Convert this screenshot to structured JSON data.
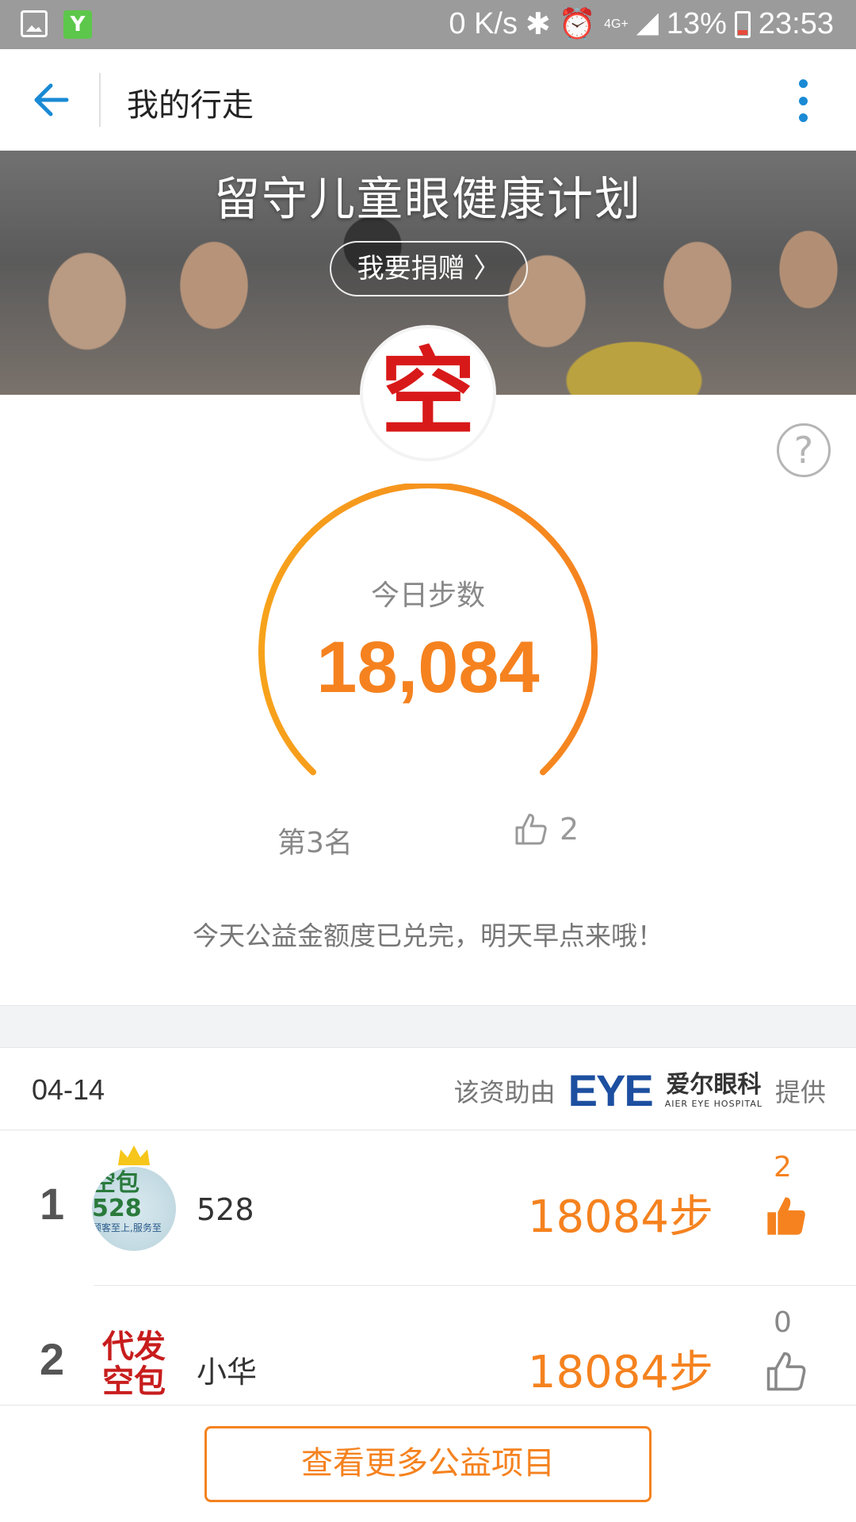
{
  "status_bar": {
    "network_speed": "0 K/s",
    "network_type": "4G+",
    "battery": "13%",
    "time": "23:53",
    "icons": [
      "image-icon",
      "y-app-icon",
      "bluetooth-icon",
      "alarm-icon",
      "signal-icon",
      "battery-icon"
    ]
  },
  "header": {
    "title": "我的行走",
    "back_icon": "arrow-left-icon",
    "more_icon": "more-vertical-icon",
    "accent_color": "#1a8ad4"
  },
  "banner": {
    "title": "留守儿童眼健康计划",
    "donate_label": "我要捐赠 〉"
  },
  "profile": {
    "avatar_text": "空",
    "help_icon": "?"
  },
  "today": {
    "label": "今日步数",
    "steps": "18,084",
    "rank": "第3名",
    "likes": "2",
    "notice": "今天公益金额度已兑完，明天早点来哦！"
  },
  "leaderboard": {
    "date": "04-14",
    "sponsor_prefix": "该资助由",
    "sponsor_logo": "EYE",
    "sponsor_name_cn": "爱尔眼科",
    "sponsor_name_en": "AIER EYE HOSPITAL",
    "sponsor_suffix": "提供",
    "rows": [
      {
        "rank": "1",
        "name": "528",
        "steps": "18084步",
        "likes": "2",
        "liked": true,
        "avatar_text_main": "空包528",
        "avatar_text_sub": "顾客至上,服务至诚。"
      },
      {
        "rank": "2",
        "name": "小华",
        "steps": "18084步",
        "likes": "0",
        "liked": false,
        "avatar_line1": "代发",
        "avatar_line2": "空包"
      }
    ]
  },
  "footer": {
    "more_label": "查看更多公益项目"
  },
  "colors": {
    "orange": "#f5821f",
    "blue": "#1a8ad4"
  }
}
